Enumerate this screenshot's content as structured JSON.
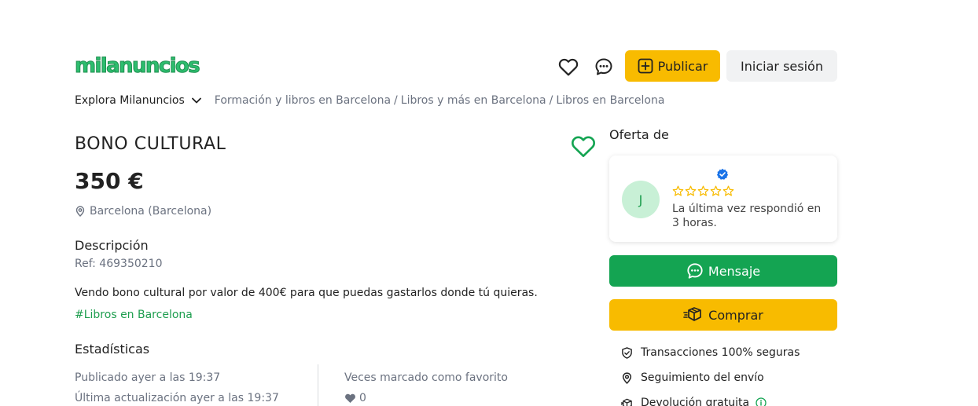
{
  "header": {
    "logo_text": "milanuncios",
    "favorites_icon": "heart-outline-icon",
    "messages_icon": "chat-bubble-icon",
    "publish_label": "Publicar",
    "login_label": "Iniciar sesión"
  },
  "breadcrumb": {
    "explore_label": "Explora Milanuncios",
    "items": [
      "Formación y libros en Barcelona",
      "Libros y más en Barcelona",
      "Libros en Barcelona"
    ],
    "separator": "/"
  },
  "listing": {
    "title": "BONO CULTURAL",
    "price": "350 €",
    "location": "Barcelona (Barcelona)",
    "description_heading": "Descripción",
    "ref": "Ref: 469350210",
    "description": "Vendo bono cultural por valor de 400€ para que puedas gastarlos donde tú quieras.",
    "tag": "#Libros en Barcelona"
  },
  "stats": {
    "heading": "Estadísticas",
    "published": "Publicado ayer a las 19:37",
    "updated": "Última actualización ayer a las 19:37",
    "favorites_label": "Veces marcado como favorito",
    "favorites_count": "0"
  },
  "seller": {
    "offer_label": "Oferta de",
    "avatar_initial": "J",
    "rating_stars": 0,
    "rating_max": 5,
    "response": "La última vez respondió en 3 horas."
  },
  "actions": {
    "message_label": "Mensaje",
    "buy_label": "Comprar"
  },
  "features": [
    {
      "label": "Transacciones 100% seguras",
      "icon": "shield-check-icon"
    },
    {
      "label": "Seguimiento del envío",
      "icon": "location-pin-icon"
    },
    {
      "label": "Devolución gratuita",
      "icon": "box-return-icon"
    }
  ],
  "colors": {
    "brand_green": "#14a452",
    "accent_yellow": "#f8bb00",
    "link_green": "#1e9e4f",
    "muted_text": "#6b7280"
  }
}
